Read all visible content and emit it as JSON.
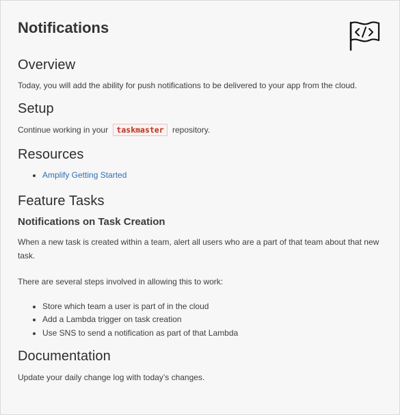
{
  "title": "Notifications",
  "overview": {
    "heading": "Overview",
    "text": "Today, you will add the ability for push notifications to be delivered to your app from the cloud."
  },
  "setup": {
    "heading": "Setup",
    "text_before": "Continue working in your",
    "repo": "taskmaster",
    "text_after": "repository."
  },
  "resources": {
    "heading": "Resources",
    "links": [
      "Amplify Getting Started"
    ]
  },
  "feature_tasks": {
    "heading": "Feature Tasks",
    "subheading": "Notifications on Task Creation",
    "para1": "When a new task is created within a team, alert all users who are a part of that team about that new task.",
    "para2": "There are several steps involved in allowing this to work:",
    "steps": [
      "Store which team a user is part of in the cloud",
      "Add a Lambda trigger on task creation",
      "Use SNS to send a notification as part of that Lambda"
    ]
  },
  "documentation": {
    "heading": "Documentation",
    "text": "Update your daily change log with today’s changes."
  },
  "icons": {
    "flag": "code-flag-icon"
  }
}
